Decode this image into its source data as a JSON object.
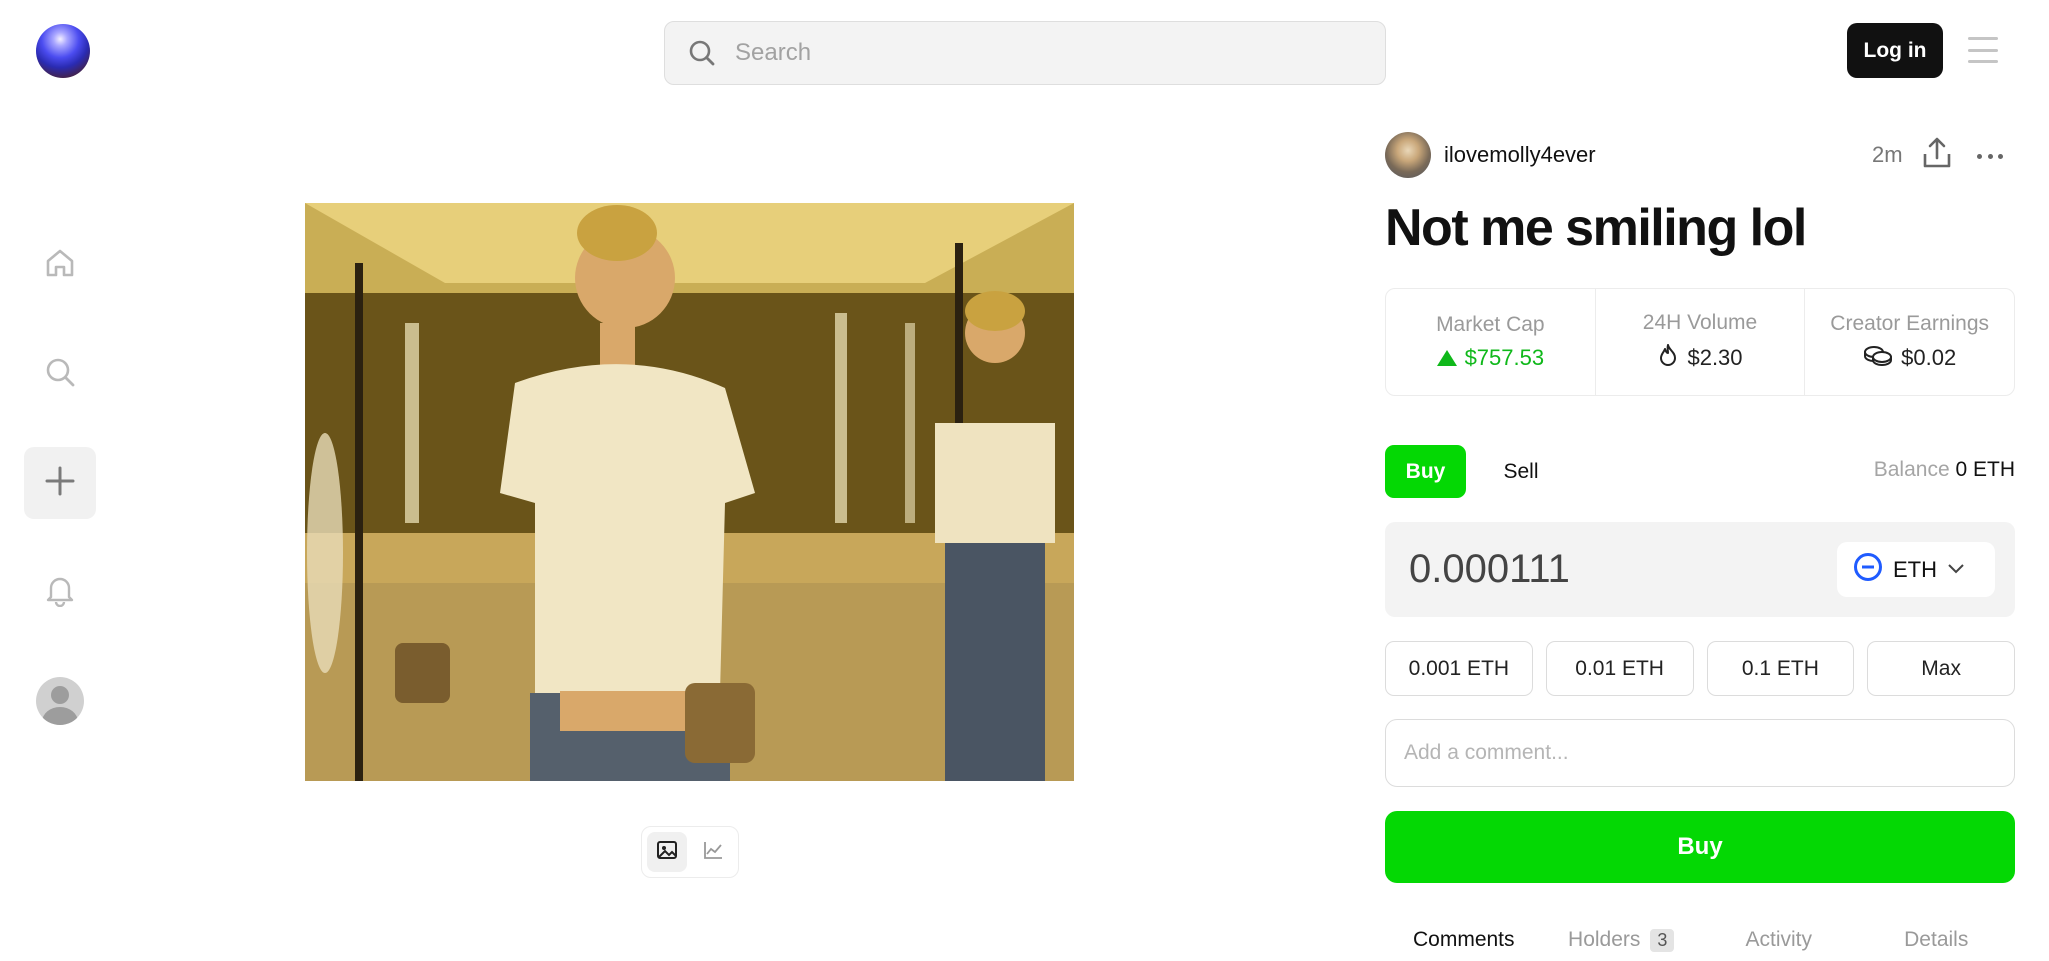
{
  "header": {
    "search_placeholder": "Search",
    "login_label": "Log in"
  },
  "sidebar": {
    "items": [
      {
        "name": "home",
        "icon": "home-icon"
      },
      {
        "name": "search",
        "icon": "search-icon"
      },
      {
        "name": "create",
        "icon": "plus-icon",
        "active": true
      },
      {
        "name": "notifications",
        "icon": "bell-icon"
      },
      {
        "name": "profile",
        "icon": "avatar"
      }
    ]
  },
  "post": {
    "creator": "ilovemolly4ever",
    "time": "2m",
    "title": "Not me smiling lol"
  },
  "stats": [
    {
      "label": "Market Cap",
      "value": "$757.53",
      "icon": "triangle-up-icon",
      "color": "#0fb81a"
    },
    {
      "label": "24H Volume",
      "value": "$2.30",
      "icon": "flame-icon"
    },
    {
      "label": "Creator Earnings",
      "value": "$0.02",
      "icon": "coins-icon"
    }
  ],
  "trade": {
    "buy_tab": "Buy",
    "sell_tab": "Sell",
    "balance_label": "Balance",
    "balance_value": "0 ETH",
    "amount": "0.000111",
    "token": "ETH",
    "presets": [
      "0.001 ETH",
      "0.01 ETH",
      "0.1 ETH",
      "Max"
    ],
    "comment_placeholder": "Add a comment...",
    "buy_button": "Buy"
  },
  "tabs": [
    {
      "label": "Comments",
      "active": true
    },
    {
      "label": "Holders",
      "badge": "3"
    },
    {
      "label": "Activity"
    },
    {
      "label": "Details"
    }
  ],
  "colors": {
    "accent_green": "#04d804",
    "up_green": "#0fb81a",
    "eth_blue": "#1f5bff"
  }
}
